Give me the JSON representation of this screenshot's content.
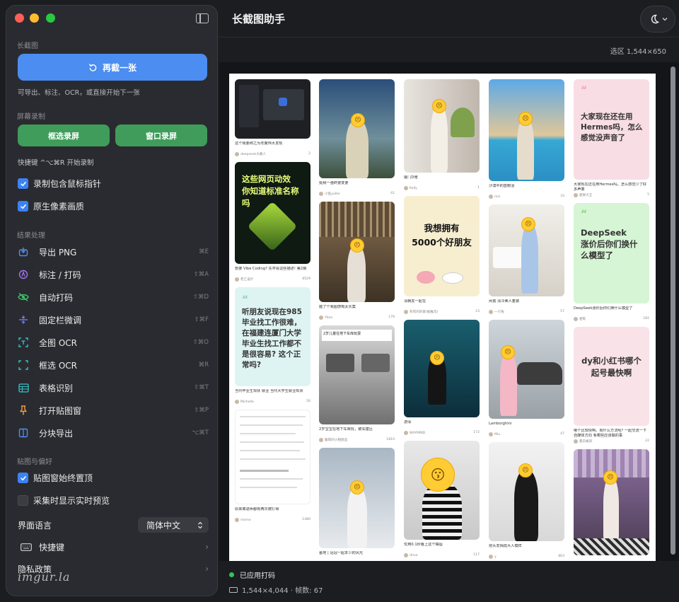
{
  "app": {
    "title": "长截图助手"
  },
  "header": {
    "selection": "选区 1,544×650"
  },
  "sidebar": {
    "section_long": "长截图",
    "again_label": "再截一张",
    "hint_after": "可导出、标注、OCR，或直接开始下一张",
    "section_record": "屏幕录制",
    "region_record": "框选录屏",
    "window_record": "窗口录屏",
    "shortcut_hint": "快捷键 ^⌥⌘R 开始录制",
    "checks": [
      {
        "label": "录制包含鼠标指针",
        "checked": true
      },
      {
        "label": "原生像素画质",
        "checked": true
      }
    ],
    "section_results": "结果处理",
    "actions": [
      {
        "label": "导出 PNG",
        "kb": "⌘E",
        "icon": "export-icon",
        "color": "#4d8ef5"
      },
      {
        "label": "标注 / 打码",
        "kb": "⇧⌘A",
        "icon": "annotate-icon",
        "color": "#a074f0"
      },
      {
        "label": "自动打码",
        "kb": "⇧⌘D",
        "icon": "eye-slash-icon",
        "color": "#3fbf6a"
      },
      {
        "label": "固定栏微调",
        "kb": "⇧⌘F",
        "icon": "pin-bar-icon",
        "color": "#6e7cf0"
      },
      {
        "label": "全图 OCR",
        "kb": "⇧⌘O",
        "icon": "ocr-full-icon",
        "color": "#39c0c8"
      },
      {
        "label": "框选 OCR",
        "kb": "⌘R",
        "icon": "ocr-region-icon",
        "color": "#39c0c8"
      },
      {
        "label": "表格识别",
        "kb": "⇧⌘T",
        "icon": "table-icon",
        "color": "#39c0c8"
      },
      {
        "label": "打开贴图窗",
        "kb": "⇧⌘P",
        "icon": "pushpin-icon",
        "color": "#f0a040"
      },
      {
        "label": "分块导出",
        "kb": "⌥⌘T",
        "icon": "split-icon",
        "color": "#4d8ef5"
      }
    ],
    "section_prefs": "贴图与偏好",
    "pref_checks": [
      {
        "label": "贴图窗始终置顶",
        "checked": true
      },
      {
        "label": "采集时显示实时预览",
        "checked": false
      }
    ],
    "language_label": "界面语言",
    "language_value": "简体中文",
    "shortcuts_label": "快捷键",
    "privacy_label": "隐私政策",
    "watermark": "imgur.la"
  },
  "status": {
    "applied": "已应用打码",
    "dims": "1,544×4,044 · 帧数: 67"
  },
  "feed": {
    "col1": [
      {
        "cap": "这个我要称之为年度伟大发现",
        "au": "deepseek大番人",
        "n": "2"
      },
      {
        "big": "这些网页动效\n你知道标准名称 吗",
        "cap": "想要 Vibe Coding? 先学会这些描述! 第2期",
        "au": "老乙设计",
        "n": "8529"
      },
      {
        "big": "听朋友说现在985毕业找工作很难，在福建连厦门大学毕业生找工作都不是很容易? 这个正常吗?",
        "cap": "当代毕业生现状 就业 当代大学生就业现状",
        "au": "Michelle",
        "n": "56"
      },
      {
        "cap": "原来离退休都有两次被打得",
        "au": "momo",
        "n": "1480"
      }
    ],
    "col2": [
      {
        "cap": "挺我一强终要变要",
        "au": "小鱼yuller",
        "n": "41"
      },
      {
        "cap": "握了个我图感慨太长案",
        "au": "Yiton",
        "n": "179"
      },
      {
        "cap": "2岁宝宝在地下车库玩，被车撞压",
        "au": "暖阳的小相屋品",
        "n": "1810"
      },
      {
        "cap": "墓地 | 冠冠一起本少的风光",
        "au": "",
        "n": ""
      }
    ],
    "col3": [
      {
        "cap": "厦门D増",
        "au": "Kelly",
        "n": "1"
      },
      {
        "big": "我想拥有\n5000个好朋友",
        "cap": "清朝友一起在",
        "au": "有有的的家(据推华)",
        "n": "23"
      },
      {
        "cap": "游泳",
        "au": "WAYMIND",
        "n": "172"
      },
      {
        "cap": "仅用0.1秒看上这个嘴唇",
        "au": "drive",
        "n": "117"
      }
    ],
    "col4": [
      {
        "cap": "沙漠中的蓝眼泪",
        "au": "mis",
        "n": "33"
      },
      {
        "cap": "闲置 清冷美人套装",
        "au": "一只兔",
        "n": "57"
      },
      {
        "cap": "Lamborghini",
        "au": "Miu",
        "n": "47"
      },
      {
        "cap": "把头发揭成大人模样",
        "au": "y",
        "n": "863"
      }
    ],
    "col5": [
      {
        "big": "大家现在还在用Hermes吗，怎么感觉没声音了",
        "cap": "大家现在还在用Hermes吗。怎么感觉少了好多声量",
        "au": "题果大王",
        "n": "5"
      },
      {
        "big": "DeepSeek\n涨价后你们换什么模型了",
        "cap": "DeepSeek涨价后你们换什么模型了",
        "au": "君陈",
        "n": "181"
      },
      {
        "big": "dy和小红书哪个起号最快啊",
        "cap": "哪个比较快啊。有什么方法呢? 一起交流一下自媒体方向 有哪些应该做的事",
        "au": "夏白桃风",
        "n": "22"
      },
      {
        "cap": "",
        "au": "",
        "n": ""
      }
    ]
  }
}
